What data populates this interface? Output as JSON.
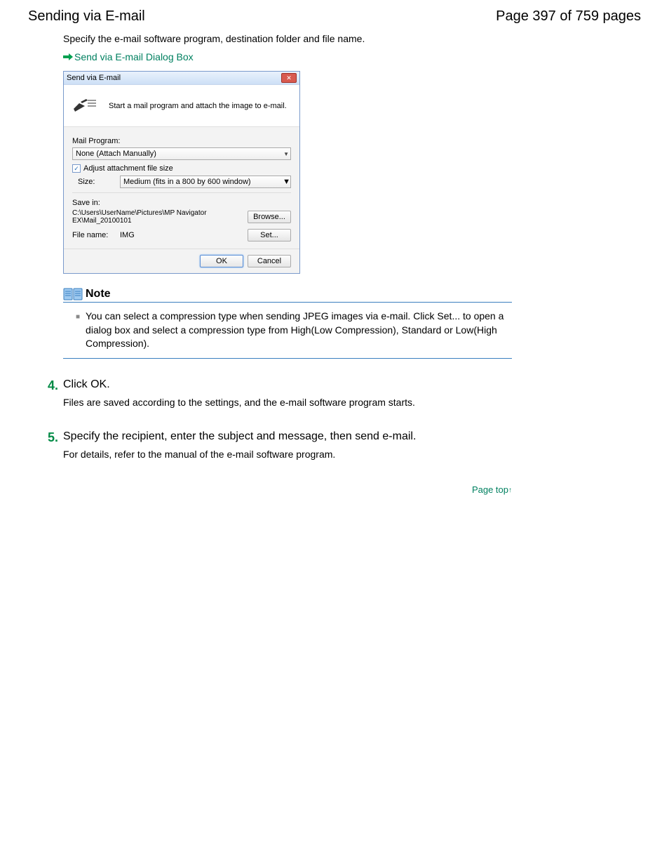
{
  "header": {
    "title": "Sending via E-mail",
    "page_position": "Page 397 of 759 pages"
  },
  "intro": "Specify the e-mail software program, destination folder and file name.",
  "link": "Send via E-mail Dialog Box",
  "dialog": {
    "title": "Send via E-mail",
    "banner": "Start a mail program and attach the image to e-mail.",
    "mail_program_label": "Mail Program:",
    "mail_program_value": "None (Attach Manually)",
    "adjust_label": "Adjust attachment file size",
    "size_label": "Size:",
    "size_value": "Medium (fits in a 800 by 600 window)",
    "save_label": "Save in:",
    "path": "C:\\Users\\UserName\\Pictures\\MP Navigator EX\\Mail_20100101",
    "browse": "Browse...",
    "filename_label": "File name:",
    "filename_value": "IMG",
    "set": "Set...",
    "ok": "OK",
    "cancel": "Cancel"
  },
  "note": {
    "title": "Note",
    "text": "You can select a compression type when sending JPEG images via e-mail. Click Set... to open a dialog box and select a compression type from High(Low Compression), Standard or Low(High Compression)."
  },
  "steps": [
    {
      "num": "4.",
      "title": "Click OK.",
      "text": "Files are saved according to the settings, and the e-mail software program starts."
    },
    {
      "num": "5.",
      "title": "Specify the recipient, enter the subject and message, then send e-mail.",
      "text": "For details, refer to the manual of the e-mail software program."
    }
  ],
  "page_top": "Page top"
}
